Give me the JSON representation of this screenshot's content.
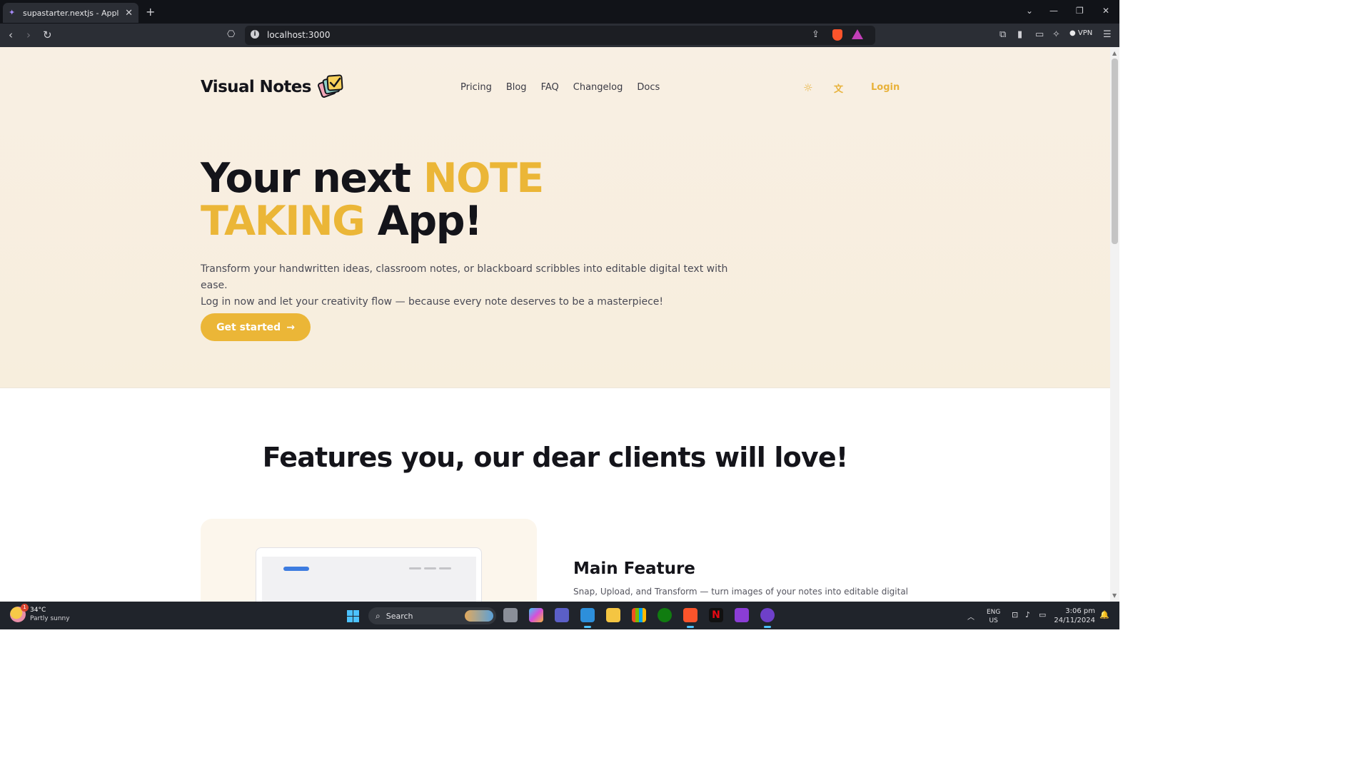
{
  "browser": {
    "tab_title": "supastarter.nextjs - Application",
    "url": "localhost:3000",
    "vpn_label": "VPN"
  },
  "site": {
    "brand": "Visual Notes",
    "nav": [
      "Pricing",
      "Blog",
      "FAQ",
      "Changelog",
      "Docs"
    ],
    "login": "Login"
  },
  "hero": {
    "headline_part1": "Your next ",
    "headline_accent1": "NOTE",
    "headline_accent2": "TAKING",
    "headline_part2": " App!",
    "subtitle_line1": "Transform your handwritten ideas, classroom notes, or blackboard scribbles into editable digital text with ease.",
    "subtitle_line2": "Log in now and let your creativity flow — because every note deserves to be a masterpiece!",
    "cta": "Get started"
  },
  "features": {
    "section_title": "Features you, our dear clients will love!",
    "main_title": "Main Feature",
    "main_desc": "Snap, Upload, and Transform — turn images of your notes into editable digital"
  },
  "taskbar": {
    "weather_temp": "34°C",
    "weather_cond": "Partly sunny",
    "weather_badge": "1",
    "search": "Search",
    "lang_top": "ENG",
    "lang_bottom": "US",
    "time": "3:06 pm",
    "date": "24/11/2024"
  },
  "colors": {
    "accent": "#ebb637",
    "hero_bg": "#f8efe3",
    "text_dark": "#14141a"
  }
}
